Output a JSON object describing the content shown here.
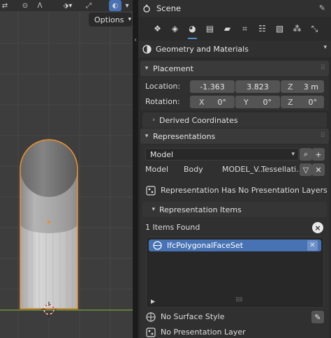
{
  "viewport": {
    "toolbar_icons": [
      "transform-icon",
      "pivot-icon",
      "proportional-icon",
      "snap-icon",
      "overlay-icon",
      "xray-icon"
    ],
    "options_label": "Options",
    "colors": {
      "background": "#3d3d3d",
      "selection_outline": "#e89030",
      "axis_green": "#7aa23a"
    }
  },
  "properties": {
    "header": {
      "scene_label": "Scene"
    },
    "tabs": [
      "tool-icon",
      "render-icon",
      "output-icon",
      "view-layer-icon",
      "scene-icon",
      "world-icon",
      "collection-icon",
      "object-icon",
      "modifier-icon",
      "particles-icon",
      "physics-icon",
      "constraints-icon"
    ],
    "context": {
      "label": "Geometry and Materials"
    },
    "placement": {
      "title": "Placement",
      "location_label": "Location:",
      "location_x": "-1.363",
      "location_y": "3.823",
      "location_z_key": "Z",
      "location_z": "3 m",
      "rotation_label": "Rotation:",
      "rot_x_key": "X",
      "rot_x": "0°",
      "rot_y_key": "Y",
      "rot_y": "0°",
      "rot_z_key": "Z",
      "rot_z": "0°"
    },
    "derived_coordinates": {
      "title": "Derived Coordinates"
    },
    "representations": {
      "title": "Representations",
      "context_select": "Model",
      "row": {
        "context": "Model",
        "subcontext": "Body",
        "target_view": "MODEL_V...",
        "type": "Tessellati..."
      },
      "no_layers": "Representation Has No Presentation Layers"
    },
    "representation_items": {
      "title": "Representation Items",
      "count_label": "1 Items Found",
      "items": [
        "IfcPolygonalFaceSet"
      ],
      "no_surface_style": "No Surface Style",
      "no_presentation_layer": "No Presentation Layer"
    },
    "colors": {
      "accent": "#4772b3",
      "panel": "#303030",
      "field": "#545454"
    }
  }
}
